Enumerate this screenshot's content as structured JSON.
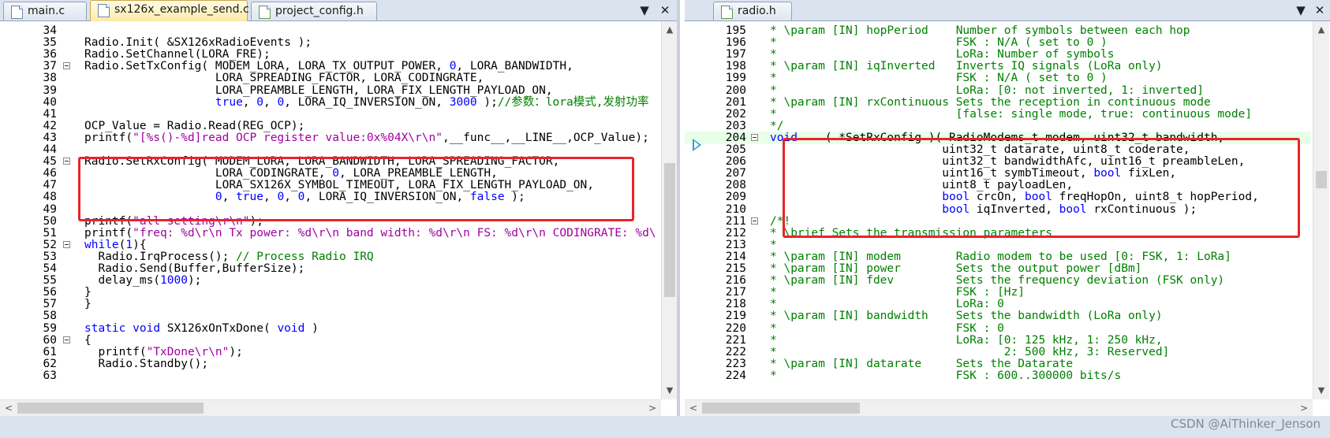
{
  "left_pane": {
    "tabs": [
      {
        "label": "main.c",
        "active": false
      },
      {
        "label": "sx126x_example_send.c",
        "active": true
      },
      {
        "label": "project_config.h",
        "active": false
      }
    ],
    "dropdown_glyph": "▼",
    "close_glyph": "✕",
    "lines": [
      {
        "n": "34",
        "fold": false,
        "code": ""
      },
      {
        "n": "35",
        "fold": false,
        "code": "Radio.Init( &SX126xRadioEvents );"
      },
      {
        "n": "36",
        "fold": false,
        "code": "Radio.SetChannel(LORA_FRE);"
      },
      {
        "n": "37",
        "fold": true,
        "code": "Radio.SetTxConfig( MODEM_LORA, LORA_TX_OUTPUT_POWER, 0, LORA_BANDWIDTH,"
      },
      {
        "n": "38",
        "fold": false,
        "code": "                   LORA_SPREADING_FACTOR, LORA_CODINGRATE,"
      },
      {
        "n": "39",
        "fold": false,
        "code": "                   LORA_PREAMBLE_LENGTH, LORA_FIX_LENGTH_PAYLOAD_ON,"
      },
      {
        "n": "40",
        "fold": false,
        "code": "                   true, 0, 0, LORA_IQ_INVERSION_ON, 3000 );//参数：lora模式,发射功率"
      },
      {
        "n": "41",
        "fold": false,
        "code": ""
      },
      {
        "n": "42",
        "fold": false,
        "code": "OCP_Value = Radio.Read(REG_OCP);"
      },
      {
        "n": "43",
        "fold": false,
        "code": "printf(\"[%s()-%d]read OCP register value:0x%04X\\r\\n\",__func__,__LINE__,OCP_Value);"
      },
      {
        "n": "44",
        "fold": false,
        "code": ""
      },
      {
        "n": "45",
        "fold": true,
        "code": "Radio.SetRxConfig( MODEM_LORA, LORA_BANDWIDTH, LORA_SPREADING_FACTOR,"
      },
      {
        "n": "46",
        "fold": false,
        "code": "                   LORA_CODINGRATE, 0, LORA_PREAMBLE_LENGTH,"
      },
      {
        "n": "47",
        "fold": false,
        "code": "                   LORA_SX126X_SYMBOL_TIMEOUT, LORA_FIX_LENGTH_PAYLOAD_ON,"
      },
      {
        "n": "48",
        "fold": false,
        "code": "                   0, true, 0, 0, LORA_IQ_INVERSION_ON, false );"
      },
      {
        "n": "49",
        "fold": false,
        "code": ""
      },
      {
        "n": "50",
        "fold": false,
        "code": "printf(\"all setting\\r\\n\");"
      },
      {
        "n": "51",
        "fold": false,
        "code": "printf(\"freq: %d\\r\\n Tx power: %d\\r\\n band width: %d\\r\\n FS: %d\\r\\n CODINGRATE: %d\\"
      },
      {
        "n": "52",
        "fold": true,
        "code": "while(1){"
      },
      {
        "n": "53",
        "fold": false,
        "code": "  Radio.IrqProcess(); // Process Radio IRQ"
      },
      {
        "n": "54",
        "fold": false,
        "code": "  Radio.Send(Buffer,BufferSize);"
      },
      {
        "n": "55",
        "fold": false,
        "code": "  delay_ms(1000);"
      },
      {
        "n": "56",
        "fold": false,
        "code": "}"
      },
      {
        "n": "57",
        "fold": false,
        "code": "}"
      },
      {
        "n": "58",
        "fold": false,
        "code": ""
      },
      {
        "n": "59",
        "fold": false,
        "code": "static void SX126xOnTxDone( void )"
      },
      {
        "n": "60",
        "fold": true,
        "code": "{"
      },
      {
        "n": "61",
        "fold": false,
        "code": "  printf(\"TxDone\\r\\n\");"
      },
      {
        "n": "62",
        "fold": false,
        "code": "  Radio.Standby();"
      },
      {
        "n": "63",
        "fold": false,
        "code": ""
      }
    ]
  },
  "right_pane": {
    "tabs": [
      {
        "label": "radio.h",
        "active": false
      }
    ],
    "dropdown_glyph": "▼",
    "close_glyph": "✕",
    "lines": [
      {
        "n": "195",
        "fold": false,
        "code": "* \\param [IN] hopPeriod    Number of symbols between each hop"
      },
      {
        "n": "196",
        "fold": false,
        "code": "*                          FSK : N/A ( set to 0 )"
      },
      {
        "n": "197",
        "fold": false,
        "code": "*                          LoRa: Number of symbols"
      },
      {
        "n": "198",
        "fold": false,
        "code": "* \\param [IN] iqInverted   Inverts IQ signals (LoRa only)"
      },
      {
        "n": "199",
        "fold": false,
        "code": "*                          FSK : N/A ( set to 0 )"
      },
      {
        "n": "200",
        "fold": false,
        "code": "*                          LoRa: [0: not inverted, 1: inverted]"
      },
      {
        "n": "201",
        "fold": false,
        "code": "* \\param [IN] rxContinuous Sets the reception in continuous mode"
      },
      {
        "n": "202",
        "fold": false,
        "code": "*                          [false: single mode, true: continuous mode]"
      },
      {
        "n": "203",
        "fold": false,
        "code": "*/"
      },
      {
        "n": "204",
        "fold": true,
        "code": "void    ( *SetRxConfig )( RadioModems_t modem, uint32_t bandwidth,"
      },
      {
        "n": "205",
        "fold": false,
        "code": "                         uint32_t datarate, uint8_t coderate,"
      },
      {
        "n": "206",
        "fold": false,
        "code": "                         uint32_t bandwidthAfc, uint16_t preambleLen,"
      },
      {
        "n": "207",
        "fold": false,
        "code": "                         uint16_t symbTimeout, bool fixLen,"
      },
      {
        "n": "208",
        "fold": false,
        "code": "                         uint8_t payloadLen,"
      },
      {
        "n": "209",
        "fold": false,
        "code": "                         bool crcOn, bool freqHopOn, uint8_t hopPeriod,"
      },
      {
        "n": "210",
        "fold": false,
        "code": "                         bool iqInverted, bool rxContinuous );"
      },
      {
        "n": "211",
        "fold": true,
        "code": "/*!"
      },
      {
        "n": "212",
        "fold": false,
        "code": "* \\brief Sets the transmission parameters"
      },
      {
        "n": "213",
        "fold": false,
        "code": "*"
      },
      {
        "n": "214",
        "fold": false,
        "code": "* \\param [IN] modem        Radio modem to be used [0: FSK, 1: LoRa]"
      },
      {
        "n": "215",
        "fold": false,
        "code": "* \\param [IN] power        Sets the output power [dBm]"
      },
      {
        "n": "216",
        "fold": false,
        "code": "* \\param [IN] fdev         Sets the frequency deviation (FSK only)"
      },
      {
        "n": "217",
        "fold": false,
        "code": "*                          FSK : [Hz]"
      },
      {
        "n": "218",
        "fold": false,
        "code": "*                          LoRa: 0"
      },
      {
        "n": "219",
        "fold": false,
        "code": "* \\param [IN] bandwidth    Sets the bandwidth (LoRa only)"
      },
      {
        "n": "220",
        "fold": false,
        "code": "*                          FSK : 0"
      },
      {
        "n": "221",
        "fold": false,
        "code": "*                          LoRa: [0: 125 kHz, 1: 250 kHz,"
      },
      {
        "n": "222",
        "fold": false,
        "code": "*                                 2: 500 kHz, 3: Reserved]"
      },
      {
        "n": "223",
        "fold": false,
        "code": "* \\param [IN] datarate     Sets the Datarate"
      },
      {
        "n": "224",
        "fold": false,
        "code": "*                          FSK : 600..300000 bits/s"
      }
    ]
  },
  "scroll_glyphs": {
    "up": "▲",
    "down": "▼",
    "left": "<",
    "right": ">"
  },
  "colors": {
    "highlight_box": "#e8242b",
    "keyword": "#0000ff",
    "comment": "#008000",
    "string": "#a000a0"
  },
  "watermark": "CSDN @AiThinker_Jenson"
}
